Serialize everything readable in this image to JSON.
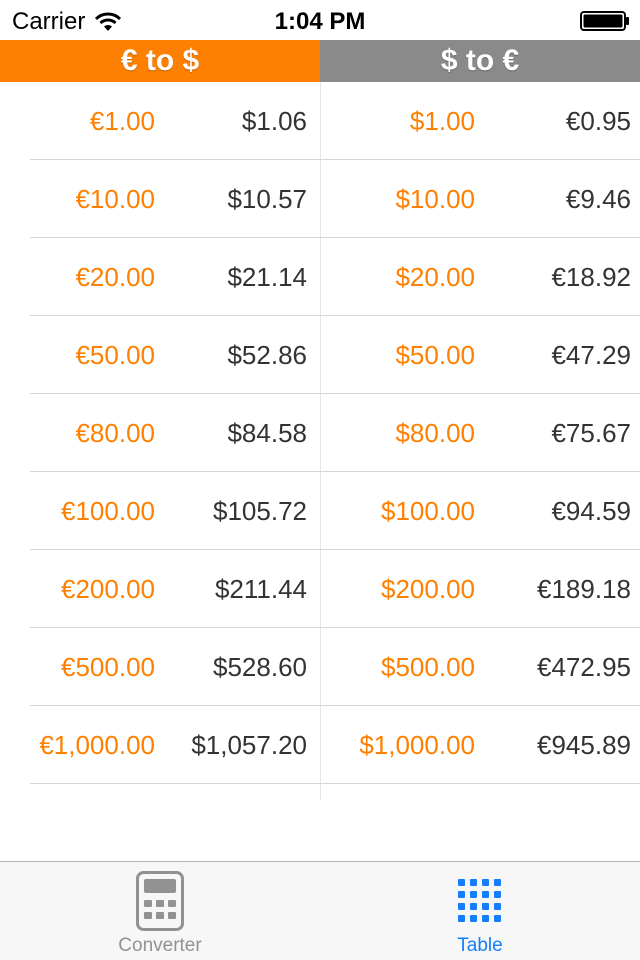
{
  "status_bar": {
    "carrier": "Carrier",
    "time": "1:04 PM",
    "wifi_icon": "wifi-icon",
    "battery_icon": "battery-icon"
  },
  "segments": [
    {
      "label": "€ to $",
      "selected": true,
      "color": "#ff8000"
    },
    {
      "label": "$ to €",
      "selected": false,
      "color": "#8a8a8a"
    }
  ],
  "colors": {
    "accent": "#ff8000",
    "text": "#333333",
    "tab_active": "#147efb",
    "tab_inactive": "#929292"
  },
  "rows": [
    {
      "eur_in": "€1.00",
      "usd_out": "$1.06",
      "usd_in": "$1.00",
      "eur_out": "€0.95"
    },
    {
      "eur_in": "€10.00",
      "usd_out": "$10.57",
      "usd_in": "$10.00",
      "eur_out": "€9.46"
    },
    {
      "eur_in": "€20.00",
      "usd_out": "$21.14",
      "usd_in": "$20.00",
      "eur_out": "€18.92"
    },
    {
      "eur_in": "€50.00",
      "usd_out": "$52.86",
      "usd_in": "$50.00",
      "eur_out": "€47.29"
    },
    {
      "eur_in": "€80.00",
      "usd_out": "$84.58",
      "usd_in": "$80.00",
      "eur_out": "€75.67"
    },
    {
      "eur_in": "€100.00",
      "usd_out": "$105.72",
      "usd_in": "$100.00",
      "eur_out": "€94.59"
    },
    {
      "eur_in": "€200.00",
      "usd_out": "$211.44",
      "usd_in": "$200.00",
      "eur_out": "€189.18"
    },
    {
      "eur_in": "€500.00",
      "usd_out": "$528.60",
      "usd_in": "$500.00",
      "eur_out": "€472.95"
    },
    {
      "eur_in": "€1,000.00",
      "usd_out": "$1,057.20",
      "usd_in": "$1,000.00",
      "eur_out": "€945.89"
    }
  ],
  "tab_bar": {
    "tabs": [
      {
        "label": "Converter",
        "icon": "calculator-icon",
        "active": false
      },
      {
        "label": "Table",
        "icon": "grid-icon",
        "active": true
      }
    ]
  }
}
